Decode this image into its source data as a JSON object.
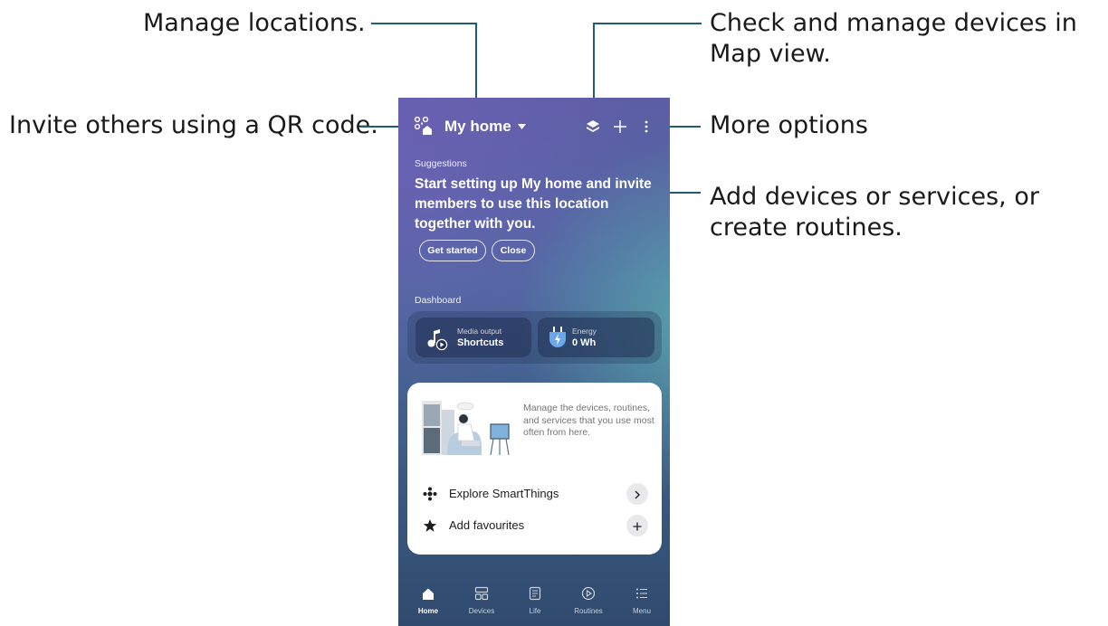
{
  "callouts": {
    "manage_locations": "Manage locations.",
    "map_view": "Check and manage devices in Map view.",
    "invite": "Invite others using a QR code.",
    "more_options": "More options",
    "add_devices": "Add devices or services, or create routines."
  },
  "header": {
    "location_title": "My home",
    "icons": [
      "qr-invite-icon",
      "caret-down-icon",
      "map-view-icon",
      "add-icon",
      "more-options-icon"
    ]
  },
  "suggestions": {
    "label": "Suggestions",
    "message": "Start setting up My home and invite members to use this location together with you.",
    "get_started": "Get started",
    "close": "Close"
  },
  "dashboard": {
    "label": "Dashboard",
    "media": {
      "subtitle": "Media output",
      "title": "Shortcuts",
      "icon": "music-note-icon"
    },
    "energy": {
      "subtitle": "Energy",
      "value": "0 Wh",
      "icon": "energy-plug-icon"
    }
  },
  "card": {
    "description": "Manage the devices, routines, and services that you use most often from here.",
    "explore": "Explore SmartThings",
    "favourites": "Add favourites"
  },
  "nav": {
    "home": "Home",
    "devices": "Devices",
    "life": "Life",
    "routines": "Routines",
    "menu": "Menu",
    "active": "Home"
  },
  "colors": {
    "callout_line": "#1f5c75",
    "phone_bg_top": "#5d5ea5",
    "phone_bg_bottom": "#2f4a6d",
    "card_bg": "#ffffff"
  }
}
